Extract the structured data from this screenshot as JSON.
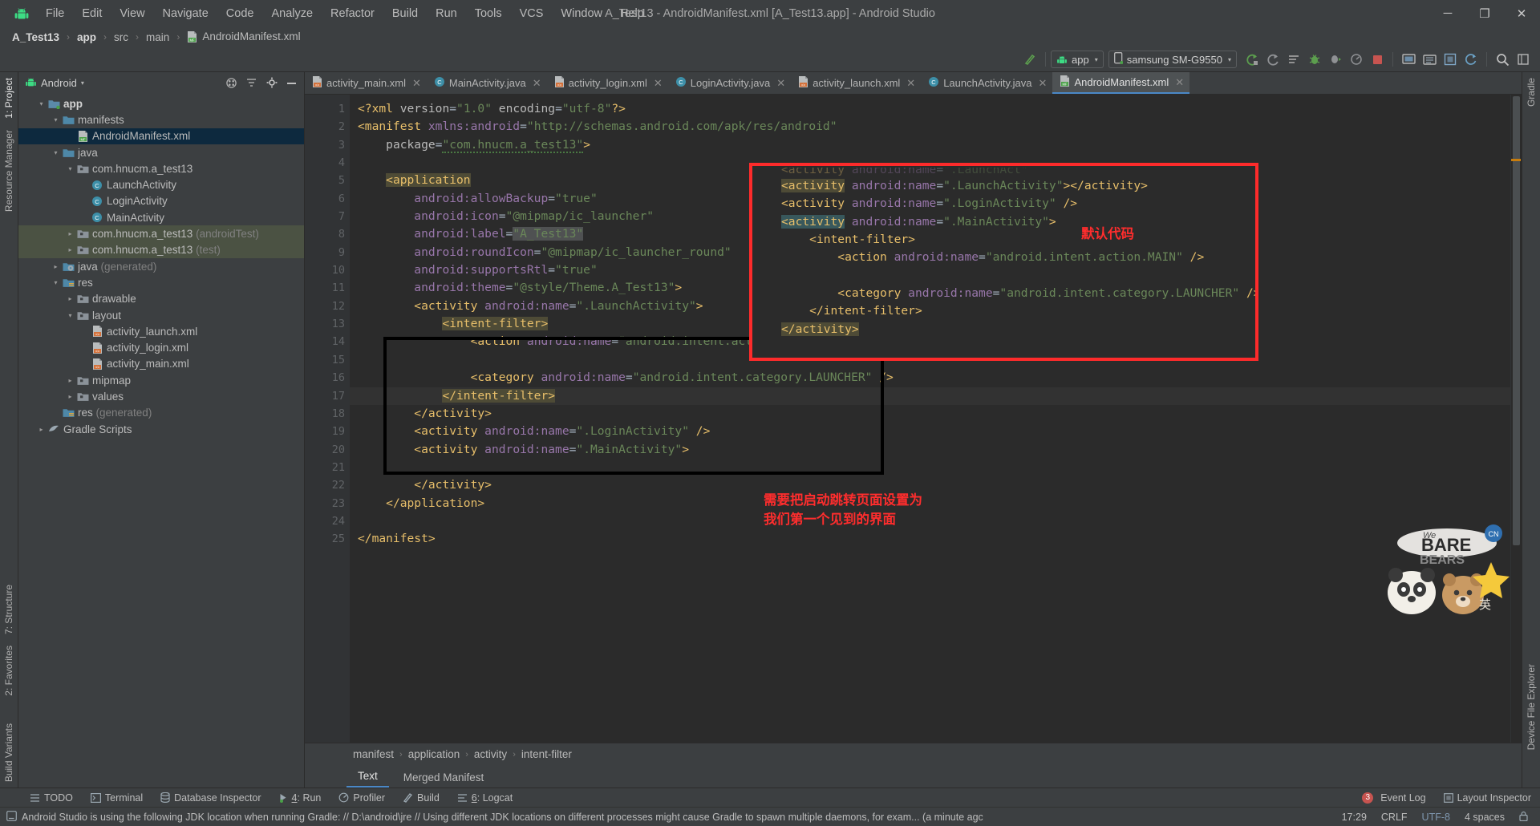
{
  "window": {
    "title": "A_Test13 - AndroidManifest.xml [A_Test13.app] - Android Studio",
    "minimize": "─",
    "maximize": "❐",
    "close": "✕"
  },
  "menubar": {
    "items": [
      "File",
      "Edit",
      "View",
      "Navigate",
      "Code",
      "Analyze",
      "Refactor",
      "Build",
      "Run",
      "Tools",
      "VCS",
      "Window",
      "Help"
    ]
  },
  "breadcrumb": {
    "items": [
      "A_Test13",
      "app",
      "src",
      "main",
      "AndroidManifest.xml"
    ],
    "separator": "›"
  },
  "toolbar": {
    "module_chip": "app",
    "device_chip": "samsung SM-G9550",
    "caret": "▾",
    "icons": [
      "build-icon",
      "run-icon",
      "rerun-icon",
      "apply-changes-icon",
      "debug-icon",
      "attach-debugger-icon",
      "profiler-icon",
      "stop-icon",
      "avd-manager-icon",
      "sdk-manager-icon",
      "layout-inspector-icon",
      "sync-gradle-icon",
      "search-icon",
      "settings-icon"
    ]
  },
  "left_rail": {
    "tabs": [
      "1: Project",
      "Resource Manager",
      "7: Structure",
      "2: Favorites",
      "Build Variants"
    ]
  },
  "right_rail": {
    "tabs": [
      "Gradle",
      "Device File Explorer"
    ]
  },
  "project_panel": {
    "header_label": "Android",
    "header_caret": "▾",
    "header_icons": [
      "expand-all-icon",
      "collapse-all-icon",
      "settings-icon",
      "hide-icon"
    ],
    "tree": [
      {
        "depth": 0,
        "arrow": "▾",
        "icon": "module-folder",
        "label": "app",
        "suffix": "",
        "bold": true,
        "state": "none"
      },
      {
        "depth": 1,
        "arrow": "▾",
        "icon": "folder-blue",
        "label": "manifests",
        "suffix": "",
        "bold": false,
        "state": "none"
      },
      {
        "depth": 2,
        "arrow": "",
        "icon": "manifest-file",
        "label": "AndroidManifest.xml",
        "suffix": "",
        "bold": false,
        "state": "selected"
      },
      {
        "depth": 1,
        "arrow": "▾",
        "icon": "folder-blue",
        "label": "java",
        "suffix": "",
        "bold": false,
        "state": "none"
      },
      {
        "depth": 2,
        "arrow": "▾",
        "icon": "package",
        "label": "com.hnucm.a_test13",
        "suffix": "",
        "bold": false,
        "state": "none"
      },
      {
        "depth": 3,
        "arrow": "",
        "icon": "class",
        "label": "LaunchActivity",
        "suffix": "",
        "bold": false,
        "state": "none"
      },
      {
        "depth": 3,
        "arrow": "",
        "icon": "class",
        "label": "LoginActivity",
        "suffix": "",
        "bold": false,
        "state": "none"
      },
      {
        "depth": 3,
        "arrow": "",
        "icon": "class",
        "label": "MainActivity",
        "suffix": "",
        "bold": false,
        "state": "none"
      },
      {
        "depth": 2,
        "arrow": "▸",
        "icon": "package",
        "label": "com.hnucm.a_test13",
        "suffix": "(androidTest)",
        "bold": false,
        "state": "greenish"
      },
      {
        "depth": 2,
        "arrow": "▸",
        "icon": "package",
        "label": "com.hnucm.a_test13",
        "suffix": "(test)",
        "bold": false,
        "state": "greenish"
      },
      {
        "depth": 1,
        "arrow": "▸",
        "icon": "folder-generated",
        "label": "java",
        "suffix": "(generated)",
        "bold": false,
        "state": "none"
      },
      {
        "depth": 1,
        "arrow": "▾",
        "icon": "folder-res",
        "label": "res",
        "suffix": "",
        "bold": false,
        "state": "none"
      },
      {
        "depth": 2,
        "arrow": "▸",
        "icon": "package",
        "label": "drawable",
        "suffix": "",
        "bold": false,
        "state": "none"
      },
      {
        "depth": 2,
        "arrow": "▾",
        "icon": "package",
        "label": "layout",
        "suffix": "",
        "bold": false,
        "state": "none"
      },
      {
        "depth": 3,
        "arrow": "",
        "icon": "layout-file",
        "label": "activity_launch.xml",
        "suffix": "",
        "bold": false,
        "state": "none"
      },
      {
        "depth": 3,
        "arrow": "",
        "icon": "layout-file",
        "label": "activity_login.xml",
        "suffix": "",
        "bold": false,
        "state": "none"
      },
      {
        "depth": 3,
        "arrow": "",
        "icon": "layout-file",
        "label": "activity_main.xml",
        "suffix": "",
        "bold": false,
        "state": "none"
      },
      {
        "depth": 2,
        "arrow": "▸",
        "icon": "package",
        "label": "mipmap",
        "suffix": "",
        "bold": false,
        "state": "none"
      },
      {
        "depth": 2,
        "arrow": "▸",
        "icon": "package",
        "label": "values",
        "suffix": "",
        "bold": false,
        "state": "none"
      },
      {
        "depth": 1,
        "arrow": "",
        "icon": "folder-res",
        "label": "res",
        "suffix": "(generated)",
        "bold": false,
        "state": "none"
      },
      {
        "depth": 0,
        "arrow": "▸",
        "icon": "gradle",
        "label": "Gradle Scripts",
        "suffix": "",
        "bold": false,
        "state": "none"
      }
    ]
  },
  "editor_tabs": [
    {
      "label": "activity_main.xml",
      "icon": "layout-file",
      "active": false
    },
    {
      "label": "MainActivity.java",
      "icon": "class",
      "active": false
    },
    {
      "label": "activity_login.xml",
      "icon": "layout-file",
      "active": false
    },
    {
      "label": "LoginActivity.java",
      "icon": "class",
      "active": false
    },
    {
      "label": "activity_launch.xml",
      "icon": "layout-file",
      "active": false
    },
    {
      "label": "LaunchActivity.java",
      "icon": "class",
      "active": false
    },
    {
      "label": "AndroidManifest.xml",
      "icon": "manifest-file",
      "active": true
    }
  ],
  "editor": {
    "close_glyph": "✕",
    "line_numbers": [
      1,
      2,
      3,
      4,
      5,
      6,
      7,
      8,
      9,
      10,
      11,
      12,
      13,
      14,
      15,
      16,
      17,
      18,
      19,
      20,
      21,
      22,
      23,
      24,
      25
    ],
    "highlighted_line": 17,
    "lines": [
      {
        "n": 1,
        "indent": 0,
        "html": "<span class=\"t-pi\">&lt;?xml</span> <span class=\"t-attr\">version</span><span class=\"t-eq\">=</span><span class=\"t-val\">\"1.0\"</span> <span class=\"t-attr\">encoding</span><span class=\"t-eq\">=</span><span class=\"t-val\">\"utf-8\"</span><span class=\"t-pi\">?&gt;</span>"
      },
      {
        "n": 2,
        "indent": 0,
        "html": "<span class=\"t-tag\">&lt;manifest</span> <span class=\"t-ns\">xmlns:android</span><span class=\"t-eq\">=</span><span class=\"t-val\">\"http://schemas.android.com/apk/res/android\"</span>"
      },
      {
        "n": 3,
        "indent": 0,
        "html": "    <span class=\"t-attr\">package</span><span class=\"t-eq\">=</span><span class=\"t-val squig\">\"com.hnucm.a_test13\"</span><span class=\"t-tag\">&gt;</span>"
      },
      {
        "n": 4,
        "indent": 0,
        "html": ""
      },
      {
        "n": 5,
        "indent": 0,
        "html": "    <span class=\"hl-app\">&lt;application</span>"
      },
      {
        "n": 6,
        "indent": 0,
        "html": "        <span class=\"t-ns\">android:allowBackup</span><span class=\"t-eq\">=</span><span class=\"t-val\">\"true\"</span>"
      },
      {
        "n": 7,
        "indent": 0,
        "html": "        <span class=\"t-ns\">android:icon</span><span class=\"t-eq\">=</span><span class=\"t-val\">\"@mipmap/ic_launcher\"</span>"
      },
      {
        "n": 8,
        "indent": 0,
        "html": "        <span class=\"t-ns\">android:label</span><span class=\"t-eq\">=</span><span class=\"t-val hl-lbl\">\"A_Test13\"</span>"
      },
      {
        "n": 9,
        "indent": 0,
        "html": "        <span class=\"t-ns\">android:roundIcon</span><span class=\"t-eq\">=</span><span class=\"t-val\">\"@mipmap/ic_launcher_round\"</span>"
      },
      {
        "n": 10,
        "indent": 0,
        "html": "        <span class=\"t-ns\">android:supportsRtl</span><span class=\"t-eq\">=</span><span class=\"t-val\">\"true\"</span>"
      },
      {
        "n": 11,
        "indent": 0,
        "html": "        <span class=\"t-ns\">android:theme</span><span class=\"t-eq\">=</span><span class=\"t-val\">\"@style/Theme.A_Test13\"</span><span class=\"t-tag\">&gt;</span>"
      },
      {
        "n": 12,
        "indent": 0,
        "html": "        <span class=\"t-tag\">&lt;activity</span> <span class=\"t-ns\">android:name</span><span class=\"t-eq\">=</span><span class=\"t-val\">\".LaunchActivity\"</span><span class=\"t-tag\">&gt;</span>"
      },
      {
        "n": 13,
        "indent": 0,
        "html": "            <span class=\"hl-app\">&lt;intent-filter&gt;</span>"
      },
      {
        "n": 14,
        "indent": 0,
        "html": "                <span class=\"t-tag\">&lt;action</span> <span class=\"t-ns\">android:name</span><span class=\"t-eq\">=</span><span class=\"t-val\">\"android.intent.action.MAIN\"</span> <span class=\"t-tag\">/&gt;</span>"
      },
      {
        "n": 15,
        "indent": 0,
        "html": ""
      },
      {
        "n": 16,
        "indent": 0,
        "html": "                <span class=\"t-tag\">&lt;category</span> <span class=\"t-ns\">android:name</span><span class=\"t-eq\">=</span><span class=\"t-val\">\"android.intent.category.LAUNCHER\"</span> <span class=\"t-tag\">/&gt;</span>"
      },
      {
        "n": 17,
        "indent": 0,
        "html": "            <span class=\"hl-app\">&lt;/intent-filter&gt;</span>"
      },
      {
        "n": 18,
        "indent": 0,
        "html": "        <span class=\"t-tag\">&lt;/activity&gt;</span>"
      },
      {
        "n": 19,
        "indent": 0,
        "html": "        <span class=\"t-tag\">&lt;activity</span> <span class=\"t-ns\">android:name</span><span class=\"t-eq\">=</span><span class=\"t-val\">\".LoginActivity\"</span> <span class=\"t-tag\">/&gt;</span>"
      },
      {
        "n": 20,
        "indent": 0,
        "html": "        <span class=\"t-tag\">&lt;activity</span> <span class=\"t-ns\">android:name</span><span class=\"t-eq\">=</span><span class=\"t-val\">\".MainActivity\"</span><span class=\"t-tag\">&gt;</span>"
      },
      {
        "n": 21,
        "indent": 0,
        "html": ""
      },
      {
        "n": 22,
        "indent": 0,
        "html": "        <span class=\"t-tag\">&lt;/activity&gt;</span>"
      },
      {
        "n": 23,
        "indent": 0,
        "html": "    <span class=\"t-tag\">&lt;/application&gt;</span>"
      },
      {
        "n": 24,
        "indent": 0,
        "html": ""
      },
      {
        "n": 25,
        "indent": 0,
        "html": "<span class=\"t-tag\">&lt;/manifest&gt;</span>"
      }
    ],
    "fold_lines": [
      2,
      5,
      12,
      13,
      17,
      18,
      20,
      22,
      25
    ],
    "image_gutter_lines": [
      7,
      9
    ]
  },
  "overlay_inset": {
    "border_color": "#fd2b2b",
    "lines": [
      {
        "html": "<span class=\"t-tag\">&lt;activity</span> <span class=\"t-ns\">android:name</span><span class=\"t-eq\">=</span><span class=\"t-val\">\".LaunchAct\"</span>",
        "cut_top": true
      },
      {
        "html": "<span class=\"hl-app\">&lt;activity</span> <span class=\"t-ns\">android:name</span><span class=\"t-eq\">=</span><span class=\"t-val\">\".LaunchActivity\"</span><span class=\"t-tag\">&gt;&lt;/activity&gt;</span>"
      },
      {
        "html": "<span class=\"t-tag\">&lt;activity</span> <span class=\"t-ns\">android:name</span><span class=\"t-eq\">=</span><span class=\"t-val\">\".LoginActivity\"</span> <span class=\"t-tag\">/&gt;</span>"
      },
      {
        "html": "<span class=\"hl-sel\">&lt;activity</span> <span class=\"t-ns\">android:name</span><span class=\"t-eq\">=</span><span class=\"t-val\">\".MainActivity\"</span><span class=\"t-tag\">&gt;</span>"
      },
      {
        "html": "    <span class=\"t-tag\">&lt;intent-filter&gt;</span>"
      },
      {
        "html": "        <span class=\"t-tag\">&lt;action</span> <span class=\"t-ns\">android:name</span><span class=\"t-eq\">=</span><span class=\"t-val\">\"android.intent.action.MAIN\"</span> <span class=\"t-tag\">/&gt;</span>"
      },
      {
        "html": ""
      },
      {
        "html": "        <span class=\"t-tag\">&lt;category</span> <span class=\"t-ns\">android:name</span><span class=\"t-eq\">=</span><span class=\"t-val\">\"android.intent.category.LAUNCHER\"</span> <span class=\"t-tag\">/&gt;</span>"
      },
      {
        "html": "    <span class=\"t-tag\">&lt;/intent-filter&gt;</span>"
      },
      {
        "html": "<span class=\"hl-app\">&lt;/activity&gt;</span>"
      }
    ]
  },
  "annotations": {
    "default_code": "默认代码",
    "need_launch": "需要把启动跳转页面设置为\n我们第一个见到的界面"
  },
  "bottom_breadcrumb": {
    "items": [
      "manifest",
      "application",
      "activity",
      "intent-filter"
    ],
    "separator": "›"
  },
  "editor_view_tabs": [
    {
      "label": "Text",
      "active": true
    },
    {
      "label": "Merged Manifest",
      "active": false
    }
  ],
  "tool_window_bar": {
    "left_items": [
      {
        "label": "TODO",
        "icon": "todo-icon",
        "mnemonic": ""
      },
      {
        "label": "Terminal",
        "icon": "terminal-icon",
        "mnemonic": ""
      },
      {
        "label": "Database Inspector",
        "icon": "database-icon",
        "mnemonic": ""
      },
      {
        "label": "Run",
        "icon": "run-icon",
        "mnemonic": "4"
      },
      {
        "label": "Profiler",
        "icon": "profiler-icon",
        "mnemonic": ""
      },
      {
        "label": "Build",
        "icon": "build-icon",
        "mnemonic": ""
      },
      {
        "label": "Logcat",
        "icon": "logcat-icon",
        "mnemonic": "6"
      }
    ],
    "right_items": [
      {
        "label": "Event Log",
        "icon": "event-log-icon",
        "badge": "3"
      },
      {
        "label": "Layout Inspector",
        "icon": "layout-inspector-icon",
        "badge": ""
      }
    ]
  },
  "statusbar": {
    "message": "Android Studio is using the following JDK location when running Gradle: // D:\\android\\jre // Using different JDK locations on different processes might cause Gradle to spawn multiple daemons, for exam... (a minute agc",
    "time": "17:29",
    "line_sep": "CRLF",
    "encoding": "UTF-8",
    "indent": "4 spaces"
  },
  "colors": {
    "accent_blue": "#4a88c7",
    "android_green": "#3ddc84",
    "annotation_red": "#ff2d2d",
    "selection_blue": "#0d293e"
  }
}
